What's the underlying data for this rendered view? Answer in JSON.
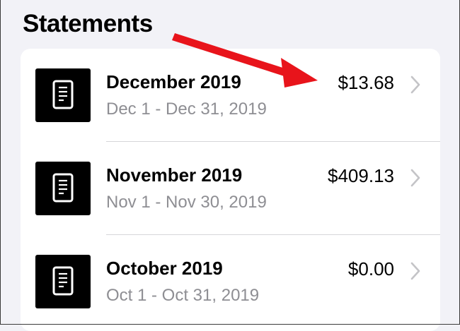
{
  "section_title": "Statements",
  "statements": [
    {
      "icon": "document-icon",
      "title": "December 2019",
      "range": "Dec 1 - Dec 31, 2019",
      "amount": "$13.68"
    },
    {
      "icon": "document-icon",
      "title": "November 2019",
      "range": "Nov 1 - Nov 30, 2019",
      "amount": "$409.13"
    },
    {
      "icon": "document-icon",
      "title": "October 2019",
      "range": "Oct 1 - Oct 31, 2019",
      "amount": "$0.00"
    }
  ],
  "annotation": {
    "type": "red-arrow",
    "color": "#e8141b",
    "points_to": "December 2019 amount"
  },
  "colors": {
    "background": "#f2f2f7",
    "card": "#ffffff",
    "secondary_text": "#8e8e93",
    "chevron": "#c4c4c7"
  }
}
